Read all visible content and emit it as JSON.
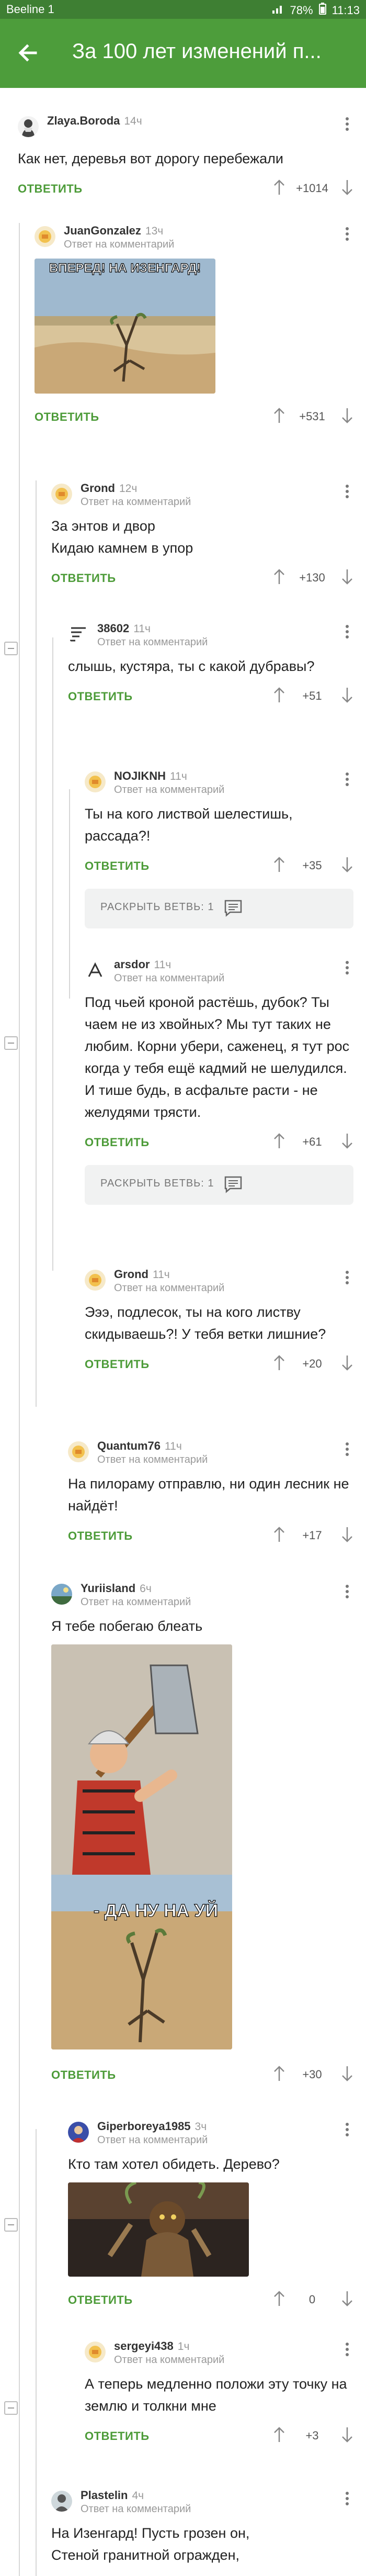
{
  "status_bar": {
    "carrier": "Beeline 1",
    "battery": "78%",
    "time": "11:13"
  },
  "header": {
    "title": "За 100 лет изменений п..."
  },
  "reply_label": "ОТВЕТИТЬ",
  "reply_to_label": "Ответ на комментарий",
  "expand_label": "РАСКРЫТЬ ВЕТВЬ: 1",
  "image_text": {
    "isengard": "ВПЕРЕД! НА ИЗЕНГАРД!",
    "da_nu_na": "- ДА НУ НА  УЙ"
  },
  "comments": [
    {
      "author": "Zlaya.Boroda",
      "time": "14ч",
      "text": "Как нет, деревья вот дорогу перебежали",
      "rating": "+1014"
    },
    {
      "author": "JuanGonzalez",
      "time": "13ч",
      "rating": "+531"
    },
    {
      "author": "Grond",
      "time": "12ч",
      "text": "За энтов и двор\nКидаю камнем в упор",
      "rating": "+130"
    },
    {
      "author": "38602",
      "time": "11ч",
      "text": "слышь, кустяра, ты с какой дубравы?",
      "rating": "+51"
    },
    {
      "author": "NOJIKNH",
      "time": "11ч",
      "text": "Ты на кого листвой шелестишь, рассада?!",
      "rating": "+35"
    },
    {
      "author": "arsdor",
      "time": "11ч",
      "text": "Под чьей кроной растёшь, дубок? Ты чаем не из хвойных? Мы тут таких не любим. Корни убери, саженец, я тут рос когда у тебя ещё кадмий не шелудился. И тише будь, в асфальте расти - не желудями трясти.",
      "rating": "+61"
    },
    {
      "author": "Grond",
      "time": "11ч",
      "text": "Эээ, подлесок, ты на кого листву скидываешь?! У тебя ветки лишние?",
      "rating": "+20"
    },
    {
      "author": "Quantum76",
      "time": "11ч",
      "text": "На пилораму отправлю, ни один лесник не найдёт!",
      "rating": "+17"
    },
    {
      "author": "Yuriisland",
      "time": "6ч",
      "text": "Я тебе побегаю блеать",
      "rating": "+30"
    },
    {
      "author": "Giperboreya1985",
      "time": "3ч",
      "text": "Кто там хотел обидеть. Дерево?",
      "rating": "0"
    },
    {
      "author": "sergeyi438",
      "time": "1ч",
      "text": "А теперь медленно положи эту точку на землю и толкни мне",
      "rating": "+3"
    },
    {
      "author": "Plastelin",
      "time": "4ч",
      "text": "На Изенгард! Пусть грозен он,\nСтеной гранитной огражден,"
    }
  ]
}
